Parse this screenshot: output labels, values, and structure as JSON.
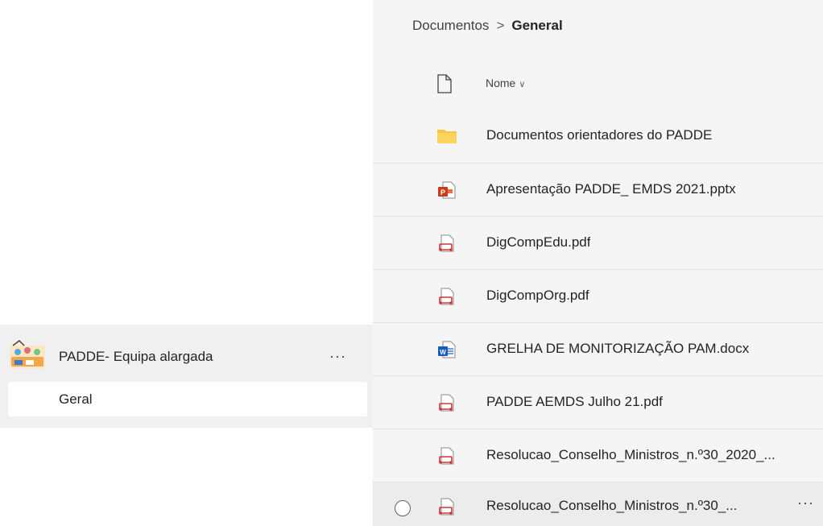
{
  "team": {
    "name": "PADDE- Equipa alargada",
    "more_label": "···",
    "channel": "Geral"
  },
  "breadcrumb": {
    "parent": "Documentos",
    "separator": ">",
    "current": "General"
  },
  "header": {
    "name_label": "Nome",
    "sort_glyph": "∨"
  },
  "files": [
    {
      "name": "Documentos orientadores do PADDE",
      "type": "folder"
    },
    {
      "name": "Apresentação PADDE_ EMDS 2021.pptx",
      "type": "pptx"
    },
    {
      "name": "DigCompEdu.pdf",
      "type": "pdf"
    },
    {
      "name": "DigCompOrg.pdf",
      "type": "pdf"
    },
    {
      "name": "GRELHA DE MONITORIZAÇÃO PAM.docx",
      "type": "docx"
    },
    {
      "name": "PADDE AEMDS Julho 21.pdf",
      "type": "pdf"
    },
    {
      "name": "Resolucao_Conselho_Ministros_n.º30_2020_...",
      "type": "pdf"
    },
    {
      "name": "Resolucao_Conselho_Ministros_n.º30_...",
      "type": "pdf",
      "more_label": "···"
    }
  ],
  "colors": {
    "folder": "#f8c642",
    "pptx": "#c43e1c",
    "docx": "#185abd",
    "pdf": "#d13438"
  }
}
